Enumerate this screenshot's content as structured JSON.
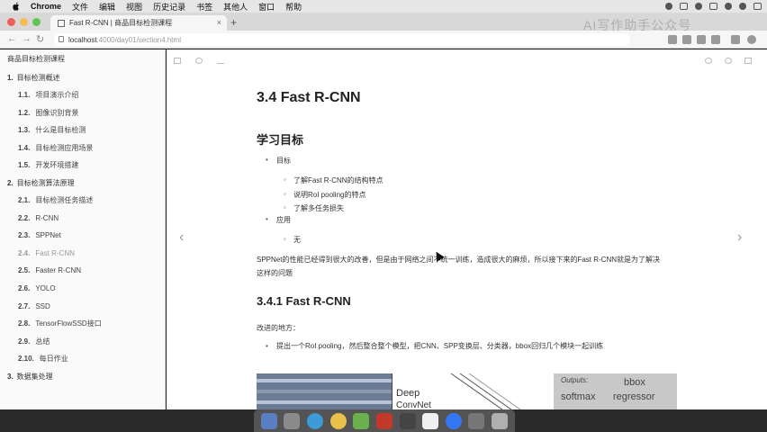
{
  "menubar": {
    "app_name": "Chrome",
    "items": [
      "文件",
      "编辑",
      "视图",
      "历史记录",
      "书签",
      "其他人",
      "窗口",
      "帮助"
    ]
  },
  "browser": {
    "tab_title": "Fast R-CNN | 商品目标检测课程",
    "url_host": "localhost",
    "url_path": ":4000/day01/section4.html",
    "watermark": "AI写作助手公众号"
  },
  "sidebar": {
    "title": "商品目标检测课程",
    "chapters": [
      {
        "num": "1.",
        "label": "目标检测概述",
        "sections": [
          {
            "num": "1.1.",
            "label": "项目演示介绍"
          },
          {
            "num": "1.2.",
            "label": "图像识别背景"
          },
          {
            "num": "1.3.",
            "label": "什么是目标检测"
          },
          {
            "num": "1.4.",
            "label": "目标检测应用场景"
          },
          {
            "num": "1.5.",
            "label": "开发环境搭建"
          }
        ]
      },
      {
        "num": "2.",
        "label": "目标检测算法原理",
        "sections": [
          {
            "num": "2.1.",
            "label": "目标检测任务描述"
          },
          {
            "num": "2.2.",
            "label": "R-CNN"
          },
          {
            "num": "2.3.",
            "label": "SPPNet"
          },
          {
            "num": "2.4.",
            "label": "Fast R-CNN"
          },
          {
            "num": "2.5.",
            "label": "Faster R-CNN"
          },
          {
            "num": "2.6.",
            "label": "YOLO"
          },
          {
            "num": "2.7.",
            "label": "SSD"
          },
          {
            "num": "2.8.",
            "label": "TensorFlowSSD接口"
          },
          {
            "num": "2.9.",
            "label": "总结"
          },
          {
            "num": "2.10.",
            "label": "每日作业"
          }
        ]
      },
      {
        "num": "3.",
        "label": "数据集处理"
      }
    ]
  },
  "content": {
    "title": "3.4 Fast R-CNN",
    "objectives_heading": "学习目标",
    "goal_label": "目标",
    "goals": [
      "了解Fast R-CNN的结构特点",
      "说明RoI pooling的特点",
      "了解多任务损失"
    ],
    "application_label": "应用",
    "application_value": "无",
    "intro_paragraph": "SPPNet的性能已经得到很大的改善，但是由于网络之间不统一训练，造成很大的麻烦，所以接下来的Fast R-CNN就是为了解决这样的问题",
    "section_heading": "3.4.1 Fast R-CNN",
    "improvements_label": "改进的地方：",
    "improvement_item": "提出一个RoI pooling，然后整合整个模型，把CNN、SPP变换层、分类器，bbox回归几个模块一起训练",
    "figure": {
      "deep_label": "Deep",
      "convnet_label": "ConvNet",
      "outputs_label": "Outputs:",
      "bbox_label": "bbox",
      "softmax_label": "softmax",
      "regressor_label": "regressor"
    }
  },
  "colors": {
    "menubar_bg": "#e6e6e6",
    "sidebar_bg": "#fafafa",
    "content_bg": "#ffffff",
    "text": "#333333"
  }
}
